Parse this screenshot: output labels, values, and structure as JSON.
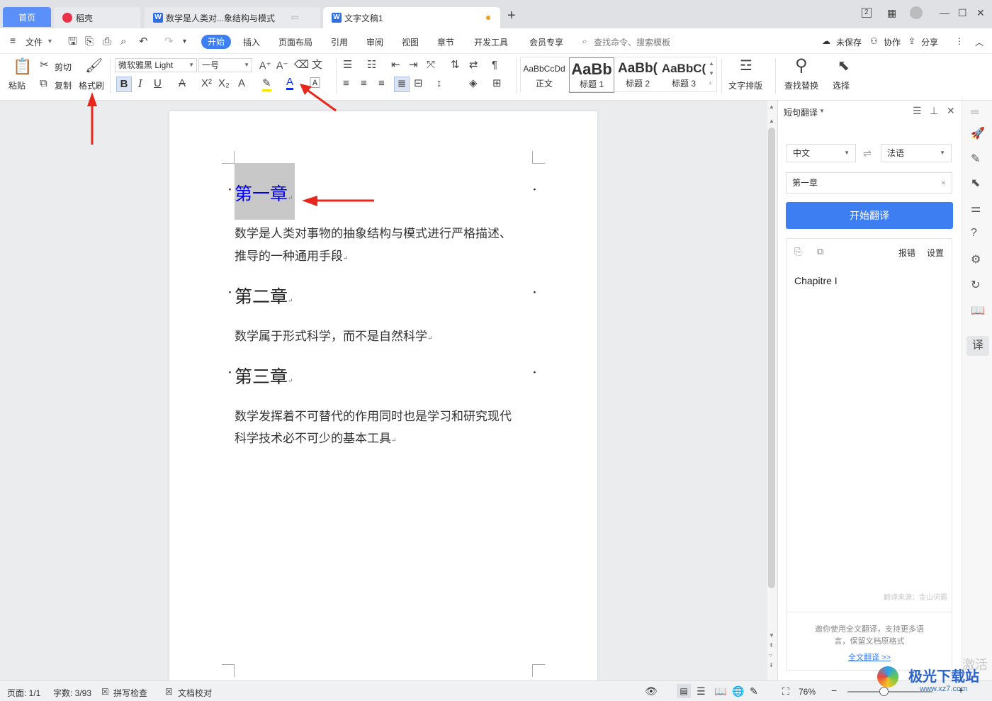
{
  "tabs": {
    "home": "首页",
    "daoke": "稻壳",
    "doc1": "数学是人类对...象结构与模式",
    "doc2": "文字文稿1",
    "new_tab": "+"
  },
  "window": {
    "layout_badge": "2"
  },
  "menu": {
    "hamburger": "≡",
    "file": "文件",
    "items": [
      "开始",
      "插入",
      "页面布局",
      "引用",
      "审阅",
      "视图",
      "章节",
      "开发工具",
      "会员专享"
    ],
    "search": "查找命令、搜索模板",
    "unsaved": "未保存",
    "collab": "协作",
    "share": "分享"
  },
  "toolbar": {
    "paste": "粘贴",
    "cut": "剪切",
    "copy": "复制",
    "format_painter": "格式刷",
    "font_name": "微软雅黑 Light",
    "font_size": "一号",
    "bold": "B",
    "italic": "I",
    "underline": "U",
    "styles": [
      {
        "preview": "AaBbCcDd",
        "label": "正文"
      },
      {
        "preview": "AaBb",
        "label": "标题 1"
      },
      {
        "preview": "AaBb(",
        "label": "标题 2"
      },
      {
        "preview": "AaBbC(",
        "label": "标题 3"
      }
    ],
    "text_layout": "文字排版",
    "find_replace": "查找替换",
    "select": "选择"
  },
  "document": {
    "h1": "第一章",
    "p1a": "数学是人类对事物的抽象结构与模式进行严格描述、",
    "p1b": "推导的一种通用手段",
    "h2": "第二章",
    "p2": "数学属于形式科学，而不是自然科学",
    "h3": "第三章",
    "p3a": "数学发挥着不可替代的作用同时也是学习和研究现代",
    "p3b": "科学技术必不可少的基本工具",
    "para_mark": "↵"
  },
  "panel": {
    "title": "短句翻译",
    "source_lang": "中文",
    "target_lang": "法语",
    "input_value": "第一章",
    "translate_button": "开始翻译",
    "report_error": "报错",
    "settings": "设置",
    "result": "Chapitre I",
    "source_credit": "翻译来源：金山词霸",
    "promo_line1": "邀你使用全文翻译，支持更多语",
    "promo_line2": "言，保留文档原格式",
    "full_translate_link": "全文翻译 >>"
  },
  "status": {
    "page": "页面: 1/1",
    "words": "字数: 3/93",
    "spell_check": "拼写检查",
    "doc_proof": "文档校对",
    "zoom": "76%"
  },
  "watermark": {
    "text1": "激活",
    "site_name": "极光下载站",
    "site_url": "www.xz7.com"
  },
  "colors": {
    "accent": "#3d7ef3",
    "heading_selected": "#0000ee",
    "annotation_arrow": "#e8271c",
    "tab_home": "#5b8ff9"
  }
}
